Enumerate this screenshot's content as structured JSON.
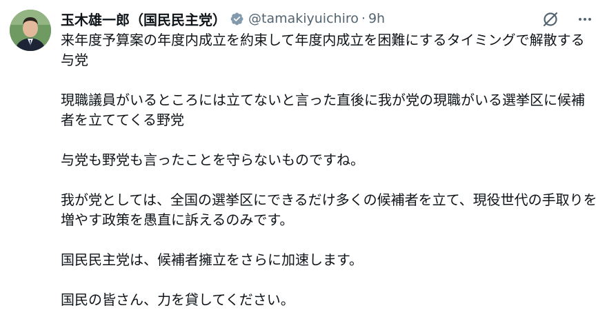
{
  "author": {
    "display_name": "玉木雄一郎（国民民主党）",
    "handle": "@tamakiyuichiro",
    "separator": "·",
    "time": "9h",
    "verified": true
  },
  "icons": {
    "verified": "verified-badge-icon",
    "grok": "grok-slash-icon",
    "more": "more-icon"
  },
  "colors": {
    "text": "#0f1419",
    "secondary": "#536471",
    "verified_badge": "#829aab"
  },
  "tweet": {
    "paragraphs": [
      "来年度予算案の年度内成立を約束して年度内成立を困難にするタイミングで解散する与党",
      "現職議員がいるところには立てないと言った直後に我が党の現職がいる選挙区に候補者を立ててくる野党",
      "与党も野党も言ったことを守らないものですね。",
      "我が党としては、全国の選挙区にできるだけ多くの候補者を立て、現役世代の手取りを増やす政策を愚直に訴えるのみです。",
      "国民民主党は、候補者擁立をさらに加速します。",
      "国民の皆さん、力を貸してください。"
    ]
  }
}
